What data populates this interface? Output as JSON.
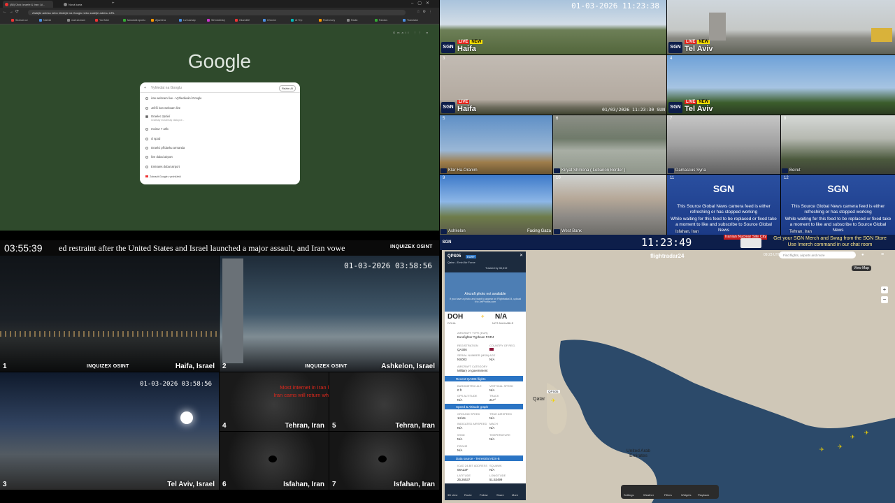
{
  "browser": {
    "tabs": [
      {
        "title": "(88) Útok Izraele & Iran: Ai...",
        "color": "#e33"
      },
      {
        "title": "Nová karta",
        "color": "#888"
      }
    ],
    "address": "Zadejte adresu nebo hledejte na Googlu nebo zadejte adresu URL",
    "bookmarks": [
      "Seznam.cz",
      "Nahrát",
      "mail.seznam",
      "YouTube",
      "fanoušek sportu",
      "Aljazeera",
      "Liveuamap",
      "Středočeský",
      "Okamžitě",
      "Chrome",
      "AI Trip",
      "Rozhovory",
      "Radio",
      "Fandos",
      "Translator"
    ],
    "logo": "Google",
    "search_placeholder": "Vyhledat na Googlu",
    "search_chip": "Režim AI",
    "suggestions": [
      "iran webcam live - Vyhledávání Google",
      "Ježíš iran webcam live",
      "Izraelec zpráví",
      "moinur 7 arllc",
      "cl spod",
      "Izraelci přídavku armanda",
      "live dubai airport",
      "Emirates dubai airport"
    ],
    "suggestion_sub": "Izraelský muslimský zástupce...",
    "footer_item": "Zobrazit Google v prohlížeči"
  },
  "cams_top": [
    {
      "num": "",
      "name": "Haifa",
      "live": "LIVE",
      "new": "NEW",
      "stamp": "01-03-2026 11:23:38"
    },
    {
      "num": "",
      "name": "Tel Aviv",
      "live": "LIVE",
      "new": "NEW",
      "stamp": ""
    },
    {
      "num": "3",
      "name": "Haifa",
      "live": "LIVE",
      "new": "",
      "stamp": "01/03/2026 11:23:30 SUN"
    },
    {
      "num": "4",
      "name": "Tel Aviv",
      "live": "LIVE",
      "new": "NEW",
      "stamp": ""
    }
  ],
  "cams_small": [
    {
      "num": "5",
      "name": "Klar Ha-Oranim"
    },
    {
      "num": "6",
      "name": "Kiryat Shmona ( Lebanon Border )"
    },
    {
      "num": "7",
      "name": "Damascus Syria"
    },
    {
      "num": "8",
      "name": "Beirut"
    },
    {
      "num": "9",
      "name": "Ashkelon"
    },
    {
      "num": "",
      "name": "Facing Gaza"
    },
    {
      "num": "10",
      "name": "West Bank"
    }
  ],
  "offline": [
    {
      "num": "11",
      "name": "Isfahan, Iran",
      "sub": "Iranian Nuclear Site City"
    },
    {
      "num": "12",
      "name": "Tehran, Iran",
      "sub": ""
    }
  ],
  "offline_brand": "SGN",
  "offline_msg1": "This Source Global News camera feed is either refreshing or has stopped working",
  "offline_msg2": "While waiting for this feed to be replaced or fixed take a moment to like and subscribe to Source Global News",
  "sgn_bar": {
    "clock": "11:23:49",
    "promo1": "Get your SGN Merch and Swag from the SGN Store",
    "promo2": "Use !merch command in our chat room"
  },
  "osint": {
    "clock": "03:55:39",
    "ticker": "ed restraint after the United States and Israel launched a major assault, and Iran vowe",
    "brand": "INQUIZEX OSINT",
    "panels": [
      {
        "num": "1",
        "name": "Haifa, Israel",
        "stamp": ""
      },
      {
        "num": "2",
        "name": "Ashkelon, Israel",
        "stamp": "01-03-2026 03:58:56"
      },
      {
        "num": "3",
        "name": "Tel Aviv, Israel",
        "stamp": "01-03-2026 03:58:56"
      },
      {
        "num": "4",
        "name": "Tehran, Iran"
      },
      {
        "num": "5",
        "name": "Tehran, Iran"
      },
      {
        "num": "6",
        "name": "Isfahan, Iran"
      },
      {
        "num": "7",
        "name": "Isfahan, Iran"
      }
    ],
    "warn1": "Most internet in Iran has been shutdown.",
    "warn2": "Iran cams will return when internet is restored."
  },
  "fr24": {
    "brand": "flightradar24",
    "search": "Find flights, airports and more",
    "view": "View",
    "map_label": "Map",
    "flight": "QPS05",
    "badge": "EURF",
    "operator": "Qatar - Emiri Air Force",
    "tracked": "Tracked by 33,319",
    "no_photo": "Aircraft photo not available",
    "photo_hint": "If you have a photo and want to appear on Flightradar24, upload it to JetPhotos.com",
    "origin": "DOH",
    "origin_city": "DOHA",
    "dest": "N/A",
    "dest_city": "NOT AVAILABLE",
    "fields": [
      {
        "label": "AIRCRAFT TYPE (EUR)",
        "value": "Eurofighter Typhoon FGR4"
      },
      {
        "label": "REGISTRATION",
        "value": "QA306"
      },
      {
        "label": "COUNTRY OF REG.",
        "value": ""
      },
      {
        "label": "SERIAL NUMBER (MSN)",
        "value": "NS003"
      },
      {
        "label": "AGE",
        "value": "N/A"
      },
      {
        "label": "AIRCRAFT CATEGORY",
        "value": "Military or government"
      }
    ],
    "sections": [
      "Recent QA306 flights",
      "Speed & Altitude graph",
      "Data source - Terrestrial ADS-B"
    ],
    "speed_fields": [
      {
        "label": "BAROMETRIC ALT.",
        "value": "0 ft"
      },
      {
        "label": "VERTICAL SPEED",
        "value": "N/A"
      },
      {
        "label": "GPS ALTITUDE",
        "value": "N/A"
      },
      {
        "label": "TRACK",
        "value": "217°"
      },
      {
        "label": "GROUND SPEED",
        "value": "14 kts"
      },
      {
        "label": "TRUE AIRSPEED",
        "value": "N/A"
      },
      {
        "label": "INDICATED AIRSPEED",
        "value": "N/A"
      },
      {
        "label": "MACH",
        "value": "N/A"
      },
      {
        "label": "WIND",
        "value": "N/A"
      },
      {
        "label": "TEMPERATURE",
        "value": "N/A"
      },
      {
        "label": "FIR/UIR",
        "value": "N/A"
      }
    ],
    "source_fields": [
      {
        "label": "ICAO 24-BIT ADDRESS",
        "value": "06A22F"
      },
      {
        "label": "SQUAWK",
        "value": "N/A"
      },
      {
        "label": "LATITUDE",
        "value": "25.26537"
      },
      {
        "label": "LONGITUDE",
        "value": "51.53499"
      }
    ],
    "left_nav": [
      "3D view",
      "Route",
      "Follow",
      "Share",
      "More"
    ],
    "map_labels": [
      {
        "text": "Qatar"
      },
      {
        "text": "United Arab Emirates"
      }
    ],
    "callout": "QPS05",
    "bottom_nav": [
      "Settings",
      "Weather",
      "Filters",
      "Widgets",
      "Playback"
    ],
    "time": "09:23 UTC"
  },
  "colors": {
    "live": "#e2231a",
    "new": "#ffe000",
    "sgn_blue": "#0d1e4a",
    "fr24_blue": "#2a74c4",
    "browser_bg": "#2f4a2c"
  }
}
